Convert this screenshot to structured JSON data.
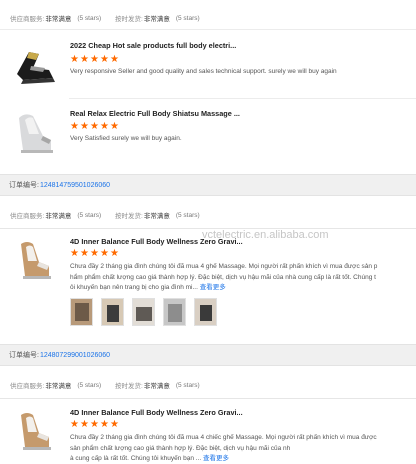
{
  "top_ratings": {
    "supplier_service_label": "供应商服务:",
    "supplier_service_value": "非常满意",
    "supplier_service_stars": "(5 stars)",
    "on_time_label": "按时发货:",
    "on_time_value": "非常满意",
    "on_time_stars": "(5 stars)"
  },
  "reviews_group1": [
    {
      "title": "2022 Cheap Hot sale products full body electri...",
      "stars": 5,
      "comment": "Very responsive Seller and good quality and sales technical support. surely we will buy again"
    },
    {
      "title": "Real Relax Electric Full Body Shiatsu Massage ...",
      "stars": 5,
      "comment": "Very Satisfied surely we will buy again."
    }
  ],
  "order1": {
    "label": "订单编号:",
    "number": "124814759501026060",
    "supplier_service_label": "供应商服务:",
    "supplier_service_value": "非常满意",
    "supplier_service_stars": "(5 stars)",
    "on_time_label": "按时发货:",
    "on_time_value": "非常满意",
    "on_time_stars": "(5 stars)",
    "review": {
      "title": "4D Inner Balance Full Body Wellness Zero Gravi...",
      "stars": 5,
      "comment_lines": [
        "Chưa đầy 2 tháng gia đình chúng tôi đã mua 4 ghế Massage. Mọi người rất phấn khích vì mua được sản p",
        "hẩm phẩm chất lượng cao giá thành hợp lý. Đặc biệt, dịch vụ hậu mãi của nhà cung cấp là rất tốt. Chúng t",
        "ôi khuyến bạn nên trang bị cho gia đình mi... "
      ],
      "more_label": "查看更多",
      "photo_count": 5
    }
  },
  "watermark": "vctelectric.en.alibaba.com",
  "order2": {
    "label": "订单编号:",
    "number": "124807299001026060",
    "supplier_service_label": "供应商服务:",
    "supplier_service_value": "非常满意",
    "supplier_service_stars": "(5 stars)",
    "on_time_label": "按时发货:",
    "on_time_value": "非常满意",
    "on_time_stars": "(5 stars)",
    "review": {
      "title": "4D Inner Balance Full Body Wellness Zero Gravi...",
      "stars": 5,
      "comment_lines": [
        "Chưa đầy 2 tháng gia đình chúng tôi đã mua 4 chiếc ghế Massage. Mọi người rất phấn khích vì mua được",
        "sản phẩm chất lượng cao giá thành hợp lý. Đặc biệt, dịch vụ hậu mãi của nh",
        "à cung cấp là rất tốt. Chúng tôi khuyến bạn ... "
      ],
      "more_label": "查看更多"
    }
  },
  "colors": {
    "accent": "#ff6a00",
    "link": "#1a73e8",
    "bar_bg": "#f0f0f0"
  }
}
